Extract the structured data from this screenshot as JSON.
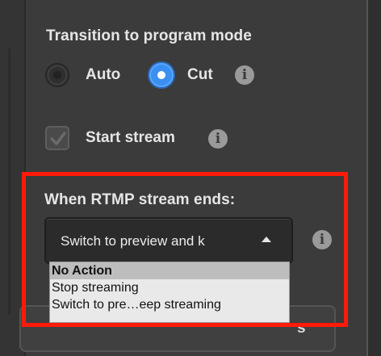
{
  "transition": {
    "heading": "Transition to program mode",
    "options": [
      {
        "label": "Auto",
        "selected": false
      },
      {
        "label": "Cut",
        "selected": true
      }
    ],
    "info_icon": "i"
  },
  "start_stream": {
    "label": "Start stream",
    "checked": true,
    "info_icon": "i"
  },
  "rtmp_end": {
    "heading": "When RTMP stream ends:",
    "selected_value": "Switch to preview and k",
    "info_icon": "i",
    "dropdown_options": [
      {
        "label": "No Action",
        "highlighted": true
      },
      {
        "label": "Stop streaming",
        "highlighted": false
      },
      {
        "label": "Switch to pre…eep streaming",
        "highlighted": false
      }
    ]
  },
  "bottom_button": {
    "label_fragment": "s"
  },
  "colors": {
    "background": "#3b3b3b",
    "accent_radio": "#3b8ff0",
    "highlight_box": "#ff1a0a",
    "dropdown_bg": "#e9e9e9"
  },
  "icons": {
    "info": "info-icon",
    "checkmark": "checkmark-icon",
    "caret": "caret-up-icon"
  }
}
